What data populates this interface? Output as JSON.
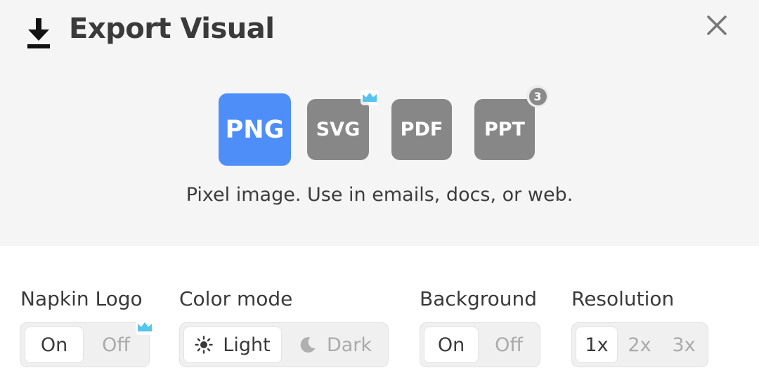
{
  "dialog": {
    "title": "Export Visual",
    "title_icon": "download-icon",
    "close_icon": "close-icon"
  },
  "formats": [
    {
      "label": "PNG",
      "selected": true,
      "color": "#4d8ef8"
    },
    {
      "label": "SVG",
      "selected": false,
      "badge": "crown-icon",
      "color": "#878787"
    },
    {
      "label": "PDF",
      "selected": false,
      "color": "#878787"
    },
    {
      "label": "PPT",
      "selected": false,
      "badge_count": "3",
      "color": "#878787"
    }
  ],
  "format_description": "Pixel image. Use in emails, docs, or web.",
  "options": {
    "logo": {
      "label": "Napkin Logo",
      "choices": [
        "On",
        "Off"
      ],
      "selected": "On",
      "badge": "crown-icon"
    },
    "color_mode": {
      "label": "Color mode",
      "choices": [
        "Light",
        "Dark"
      ],
      "selected": "Light",
      "icons": [
        "sun-icon",
        "moon-icon"
      ]
    },
    "background": {
      "label": "Background",
      "choices": [
        "On",
        "Off"
      ],
      "selected": "On"
    },
    "resolution": {
      "label": "Resolution",
      "choices": [
        "1x",
        "2x",
        "3x"
      ],
      "selected": "1x"
    }
  },
  "colors": {
    "accent": "#4d8ef8",
    "format_inactive": "#878787",
    "crown": "#56c4ef",
    "header_bg": "#f5f5f5"
  }
}
